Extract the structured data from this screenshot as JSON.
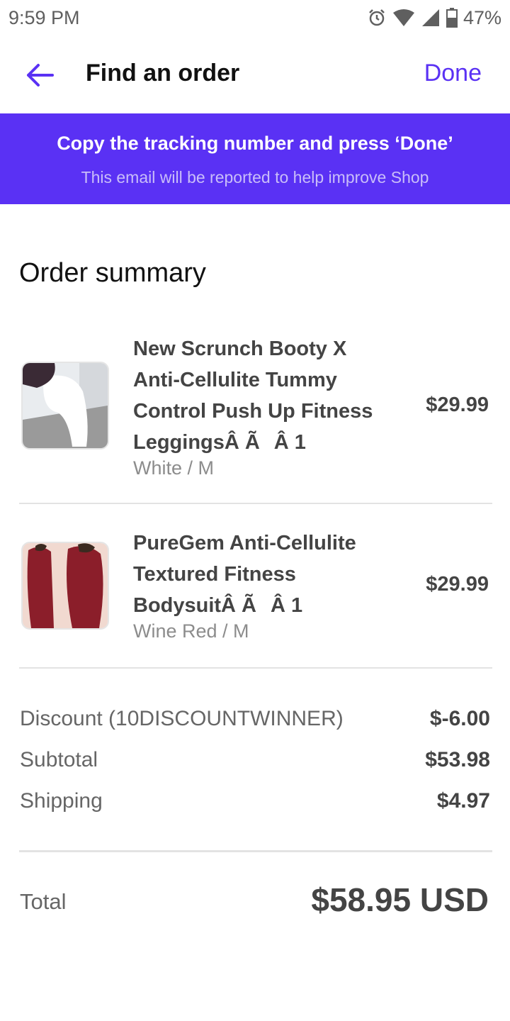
{
  "status_bar": {
    "time": "9:59 PM",
    "battery": "47%",
    "icons": [
      "alarm-icon",
      "wifi-icon",
      "signal-icon",
      "battery-icon"
    ]
  },
  "header": {
    "title": "Find an order",
    "done_label": "Done",
    "back_icon": "back-arrow-icon"
  },
  "banner": {
    "title": "Copy the tracking number and press ‘Done’",
    "subtitle": "This email will be reported to help improve Shop"
  },
  "order": {
    "heading": "Order summary",
    "items": [
      {
        "title": "New Scrunch Booty X Anti-Cellulite Tummy Control Push Up Fitness LeggingsÂ ÃÂ 1",
        "variant": "White / M",
        "price": "$29.99"
      },
      {
        "title": "PureGem Anti-Cellulite Textured Fitness BodysuitÂ ÃÂ 1",
        "variant": "Wine Red / M",
        "price": "$29.99"
      }
    ],
    "discount": {
      "label": "Discount (10DISCOUNTWINNER)",
      "value": "$-6.00"
    },
    "subtotal": {
      "label": "Subtotal",
      "value": "$53.98"
    },
    "shipping": {
      "label": "Shipping",
      "value": "$4.97"
    },
    "total": {
      "label": "Total",
      "value": "$58.95 USD"
    }
  },
  "colors": {
    "accent": "#5a31f4",
    "banner_subtitle": "#c9bdf9",
    "wine_red": "#8b1e2a"
  }
}
